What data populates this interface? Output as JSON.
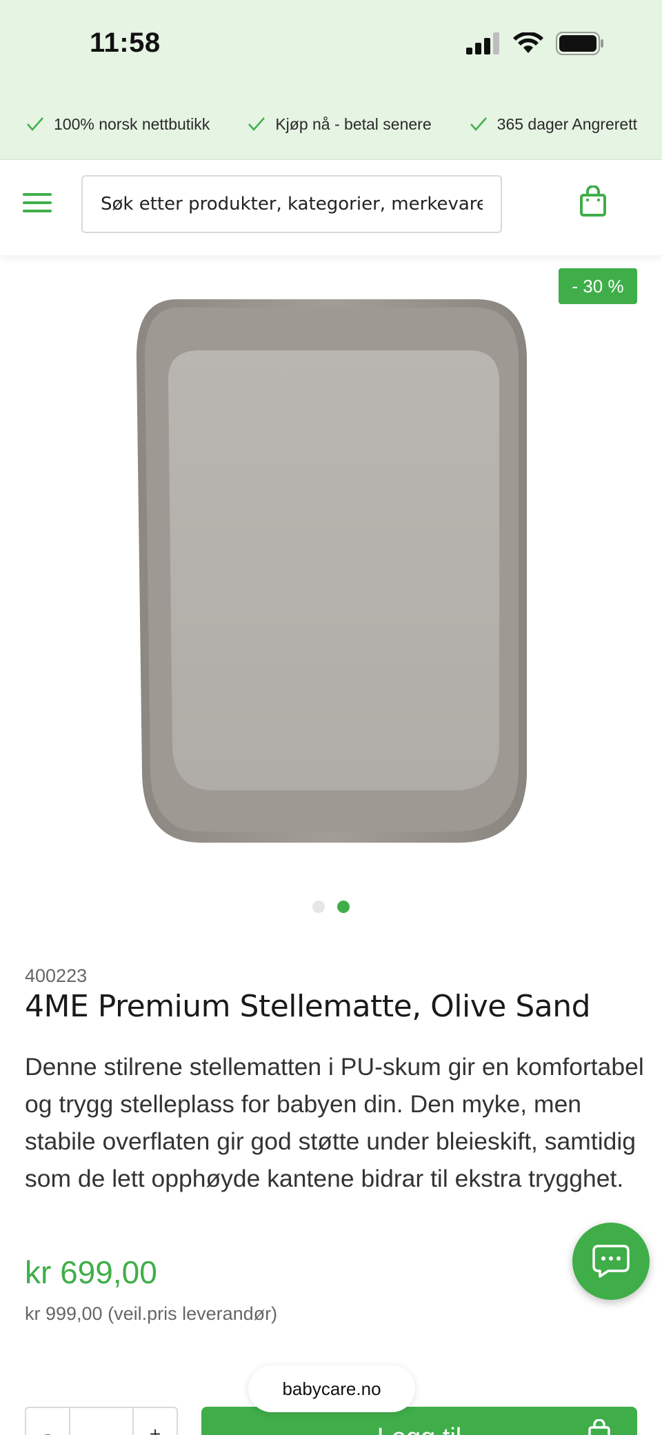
{
  "status_bar": {
    "time": "11:58"
  },
  "usp": [
    {
      "label": "100% norsk nettbutikk"
    },
    {
      "label": "Kjøp nå - betal senere"
    },
    {
      "label": "365 dager Angrerett"
    }
  ],
  "header": {
    "search_placeholder": "Søk etter produkter, kategorier, merkevarer",
    "menu_icon": "hamburger-menu-icon",
    "cart_icon": "shopping-bag-icon"
  },
  "gallery": {
    "discount_badge": "- 30 %",
    "image_count": 2,
    "active_index": 1
  },
  "product": {
    "sku": "400223",
    "title": "4ME Premium Stellematte, Olive Sand",
    "description": "Denne stilrene stellematten i PU-skum gir en komfortabel og trygg stelleplass for babyen din. Den myke, men stabile overflaten gir god støtte under bleieskift, samtidig som de lett opphøyde kantene bidrar til ekstra trygghet.",
    "price": "kr 699,00",
    "old_price": "kr 999,00 (veil.pris leverandør)"
  },
  "purchase": {
    "qty_minus": "-",
    "qty_plus": "+",
    "add_label": "Legg til"
  },
  "browser": {
    "url": "babycare.no"
  },
  "colors": {
    "accent": "#3fae49",
    "top_band": "#e6f4e3"
  }
}
